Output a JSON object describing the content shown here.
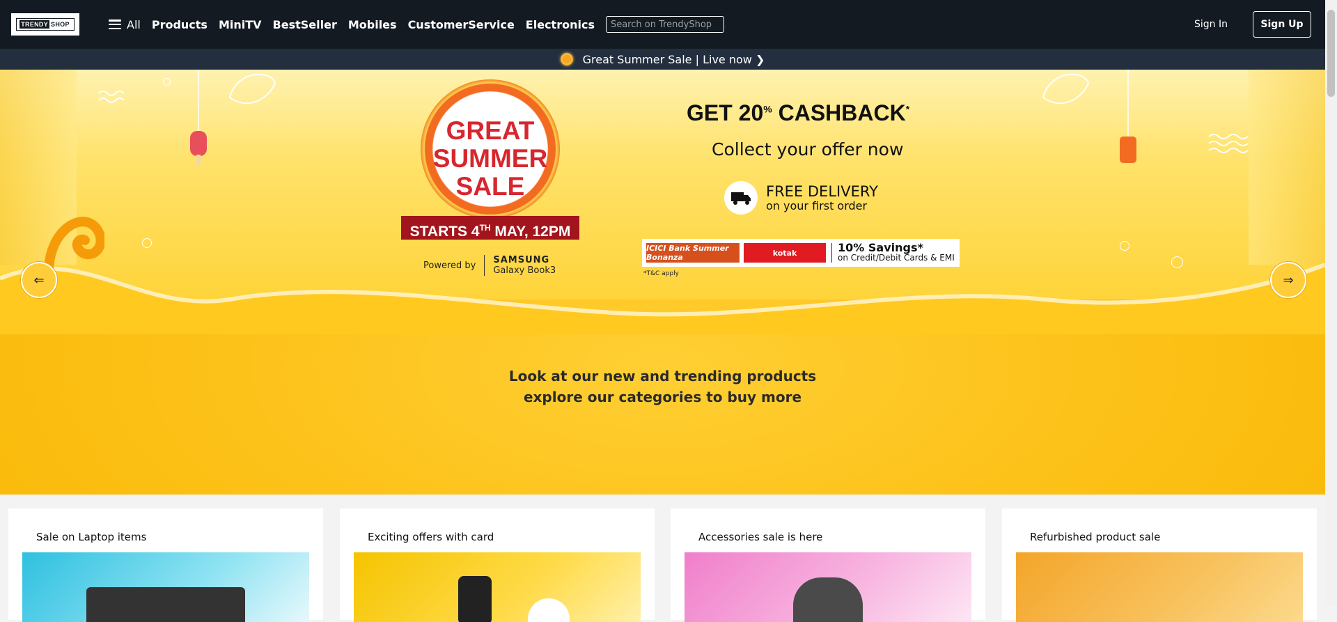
{
  "nav": {
    "logo_part1": "TRENDY",
    "logo_part2": "SHOP",
    "all_label": "All",
    "links": [
      "Products",
      "MiniTV",
      "BestSeller",
      "Mobiles",
      "CustomerService",
      "Electronics"
    ],
    "search_placeholder": "Search on TrendyShop",
    "signin_label": "Sign In",
    "signup_label": "Sign Up"
  },
  "announcement": {
    "text": "Great Summer Sale | Live now ❯"
  },
  "hero": {
    "badge_line1": "GREAT",
    "badge_line2": "SUMMER",
    "badge_line3": "SALE",
    "starts_prefix": "STARTS 4",
    "starts_sup": "TH",
    "starts_suffix": " MAY, 12PM",
    "powered_by": "Powered by",
    "brand_line1": "SAMSUNG",
    "brand_line2": "Galaxy Book3",
    "cashback_prefix": "GET 20",
    "cashback_sup": "%",
    "cashback_suffix": " CASHBACK",
    "cashback_star": "*",
    "collect": "Collect your offer now",
    "delivery_title": "FREE DELIVERY",
    "delivery_sub": "on your first order",
    "bank1": "ICICI Bank Summer Bonanza",
    "bank2": "kotak",
    "savings_title": "10% Savings*",
    "savings_sub": "on Credit/Debit Cards & EMI",
    "tnc": "*T&C apply",
    "prev_arrow": "⇐",
    "next_arrow": "⇒",
    "copy_line1": "Look at our new and trending products",
    "copy_line2": "explore our categories to buy more"
  },
  "cards": [
    {
      "title": "Sale on Laptop items",
      "bg": "#49c9e6"
    },
    {
      "title": "Exciting offers with card",
      "bg": "#f7c71e"
    },
    {
      "title": "Accessories sale is here",
      "bg": "#f5a3d8"
    },
    {
      "title": "Refurbished product sale",
      "bg": "#f7b84a"
    }
  ]
}
